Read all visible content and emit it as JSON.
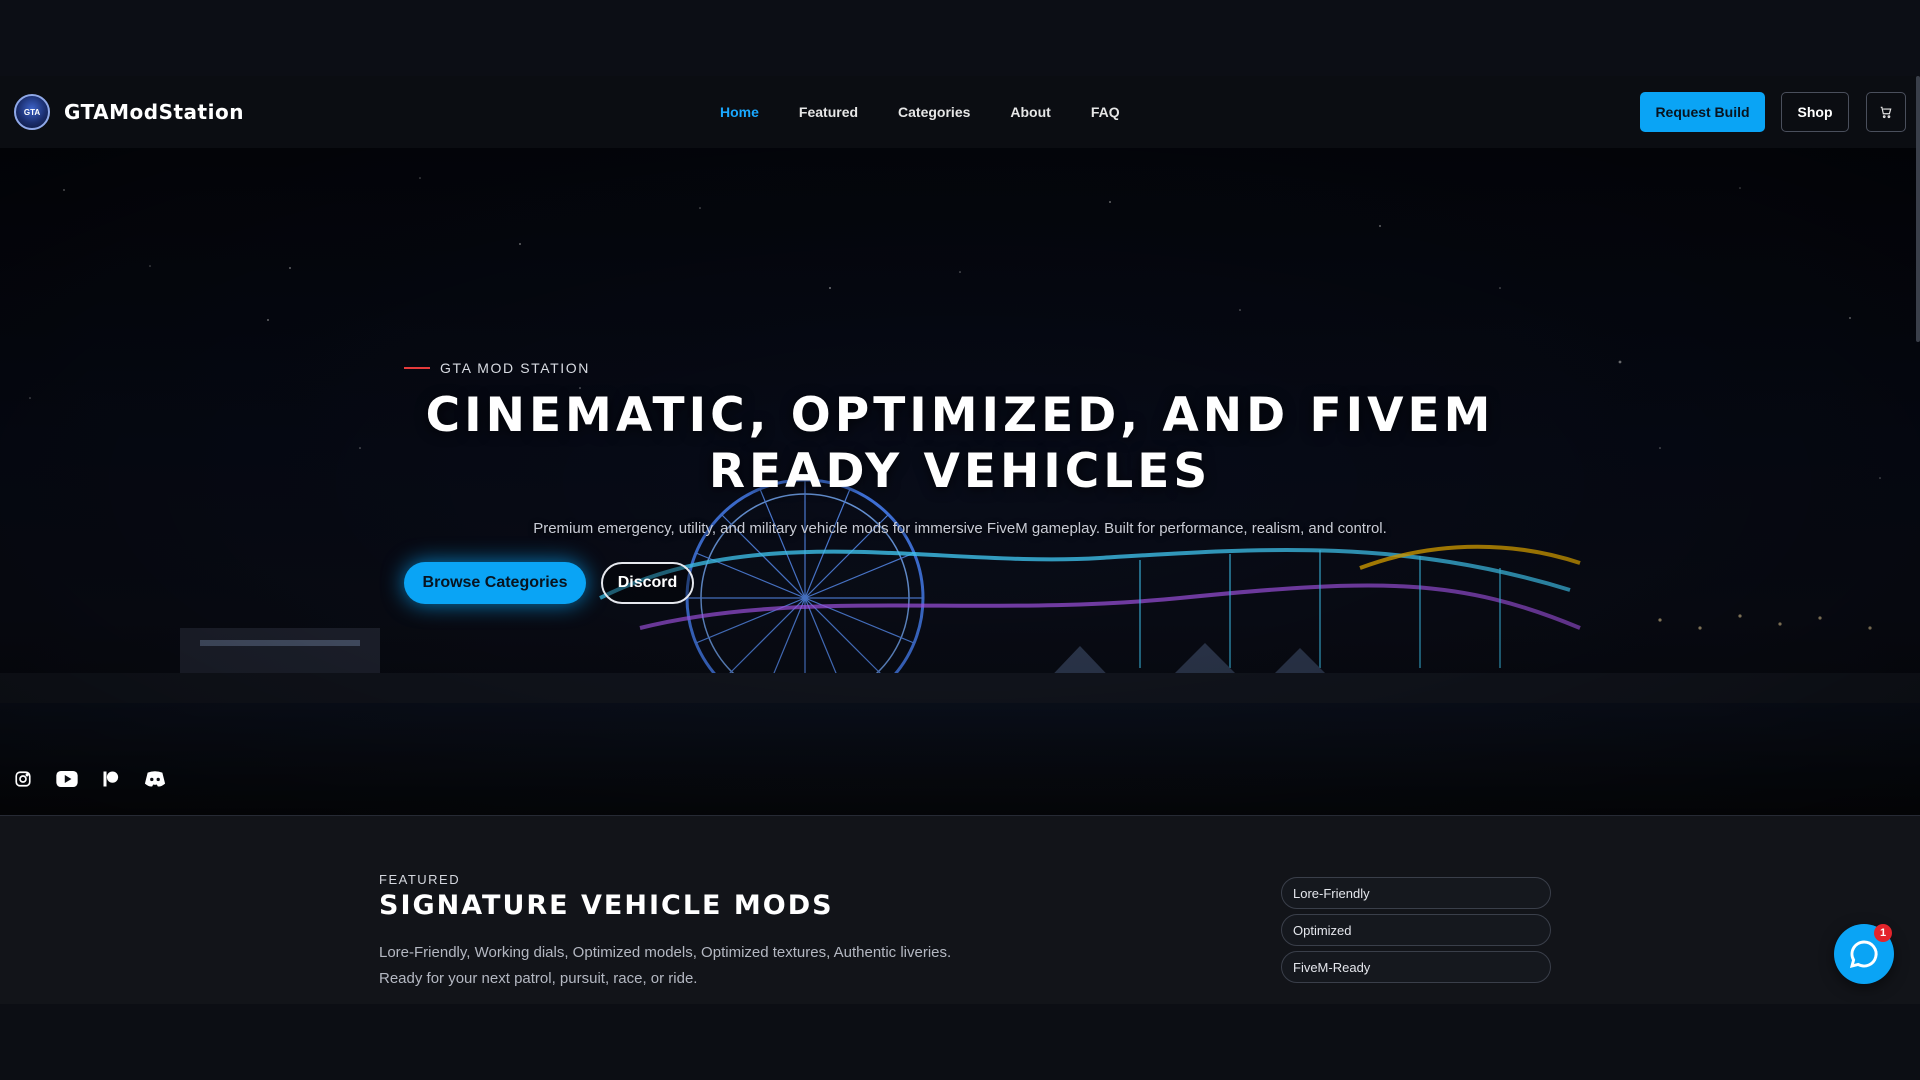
{
  "brand": {
    "name": "GTAModStation",
    "logo_text": "GTA"
  },
  "nav": {
    "links": [
      "Home",
      "Featured",
      "Categories",
      "About",
      "FAQ"
    ],
    "active": "Home",
    "request_label": "Request Build",
    "shop_label": "Shop",
    "cart_icon": "cart-icon"
  },
  "hero": {
    "eyebrow": "GTA MOD STATION",
    "title_line1": "CINEMATIC, OPTIMIZED, AND FIVEM",
    "title_line2": "READY VEHICLES",
    "subtitle": "Premium emergency, utility, and military vehicle mods for immersive FiveM gameplay. Built for performance, realism, and control.",
    "browse_label": "Browse Categories",
    "discord_label": "Discord"
  },
  "socials": [
    "instagram-icon",
    "youtube-icon",
    "patreon-icon",
    "discord-icon"
  ],
  "featured": {
    "eyebrow": "FEATURED",
    "title": "SIGNATURE VEHICLE MODS",
    "description": "Lore-Friendly, Working dials, Optimized models, Optimized textures, Authentic liveries. Ready for your next patrol, pursuit, race, or ride.",
    "tags": [
      "Lore-Friendly",
      "Optimized",
      "FiveM-Ready"
    ]
  },
  "chat": {
    "badge_count": "1"
  },
  "colors": {
    "accent": "#0aa4f5",
    "eyebrow_line": "#e53b3b",
    "badge": "#e3242b"
  }
}
